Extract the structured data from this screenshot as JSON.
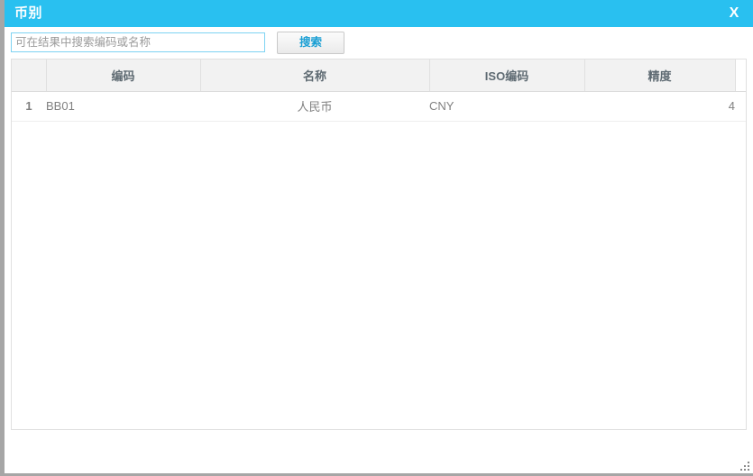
{
  "window": {
    "title": "币别",
    "close_label": "X",
    "accent_color": "#29c0f0",
    "border_color": "#a6a6a6"
  },
  "toolbar": {
    "search_placeholder": "可在结果中搜索编码或名称",
    "search_value": "",
    "search_button_label": "搜索",
    "search_button_color": "#1a9fd4"
  },
  "grid": {
    "columns": [
      {
        "key": "rownum",
        "label": ""
      },
      {
        "key": "code",
        "label": "编码"
      },
      {
        "key": "name",
        "label": "名称"
      },
      {
        "key": "iso",
        "label": "ISO编码"
      },
      {
        "key": "prec",
        "label": "精度"
      }
    ],
    "rows": [
      {
        "rownum": "1",
        "code": "BB01",
        "name": "人民币",
        "iso": "CNY",
        "prec": "4"
      }
    ]
  }
}
